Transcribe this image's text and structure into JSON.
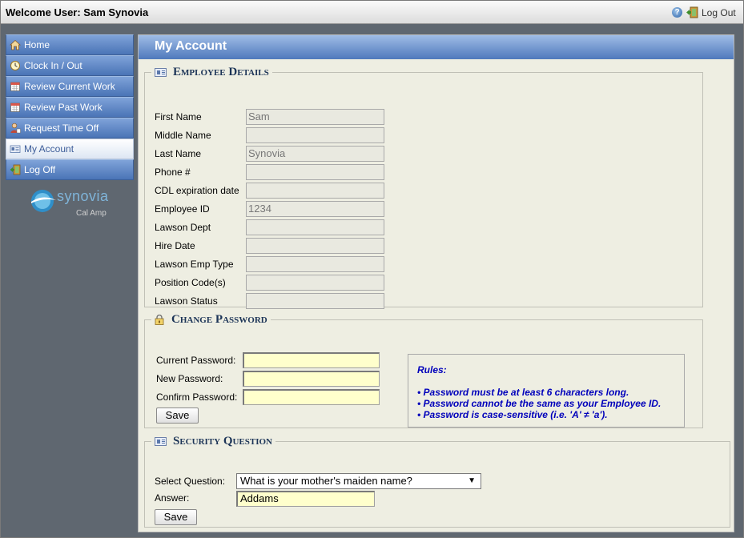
{
  "header": {
    "welcome": "Welcome User: Sam Synovia",
    "logout_label": "Log Out",
    "help_glyph": "?"
  },
  "sidebar": {
    "items": [
      {
        "label": "Home",
        "icon": "home-icon"
      },
      {
        "label": "Clock In / Out",
        "icon": "clock-icon"
      },
      {
        "label": "Review Current Work",
        "icon": "calendar-icon"
      },
      {
        "label": "Review Past Work",
        "icon": "calendar-icon"
      },
      {
        "label": "Request Time Off",
        "icon": "person-icon"
      },
      {
        "label": "My Account",
        "icon": "id-card-icon"
      },
      {
        "label": "Log Off",
        "icon": "exit-door-icon"
      }
    ],
    "active_index": 5,
    "logo_text": "synovia",
    "logo_sub": "Cal Amp"
  },
  "page_title": "My Account",
  "employee_details": {
    "legend": "Employee Details",
    "fields": [
      {
        "label": "First Name",
        "value": "Sam"
      },
      {
        "label": "Middle Name",
        "value": ""
      },
      {
        "label": "Last Name",
        "value": "Synovia"
      },
      {
        "label": "Phone #",
        "value": ""
      },
      {
        "label": "CDL expiration date",
        "value": ""
      },
      {
        "label": "Employee ID",
        "value": "1234"
      },
      {
        "label": "Lawson Dept",
        "value": ""
      },
      {
        "label": "Hire Date",
        "value": ""
      },
      {
        "label": "Lawson Emp Type",
        "value": ""
      },
      {
        "label": "Position Code(s)",
        "value": ""
      },
      {
        "label": "Lawson Status",
        "value": ""
      }
    ]
  },
  "change_password": {
    "legend": "Change Password",
    "current_label": "Current Password:",
    "new_label": "New Password:",
    "confirm_label": "Confirm Password:",
    "save_label": "Save",
    "rules_title": "Rules:",
    "rules": [
      "• Password must be at least 6 characters long.",
      "• Password cannot be the same as your Employee ID.",
      "• Password is case-sensitive (i.e. 'A' ≠ 'a')."
    ]
  },
  "security_question": {
    "legend": "Security Question",
    "select_label": "Select Question:",
    "selected_question": "What is your mother's maiden name?",
    "answer_label": "Answer:",
    "answer_value": "Addams",
    "save_label": "Save"
  },
  "colors": {
    "nav_blue": "#4a74b6",
    "header_blue": "#4f79bc",
    "panel_bg": "#eeeee2",
    "input_yellow": "#ffffcc",
    "rules_text": "#0000bb",
    "sidebar_bg": "#5f6770"
  }
}
